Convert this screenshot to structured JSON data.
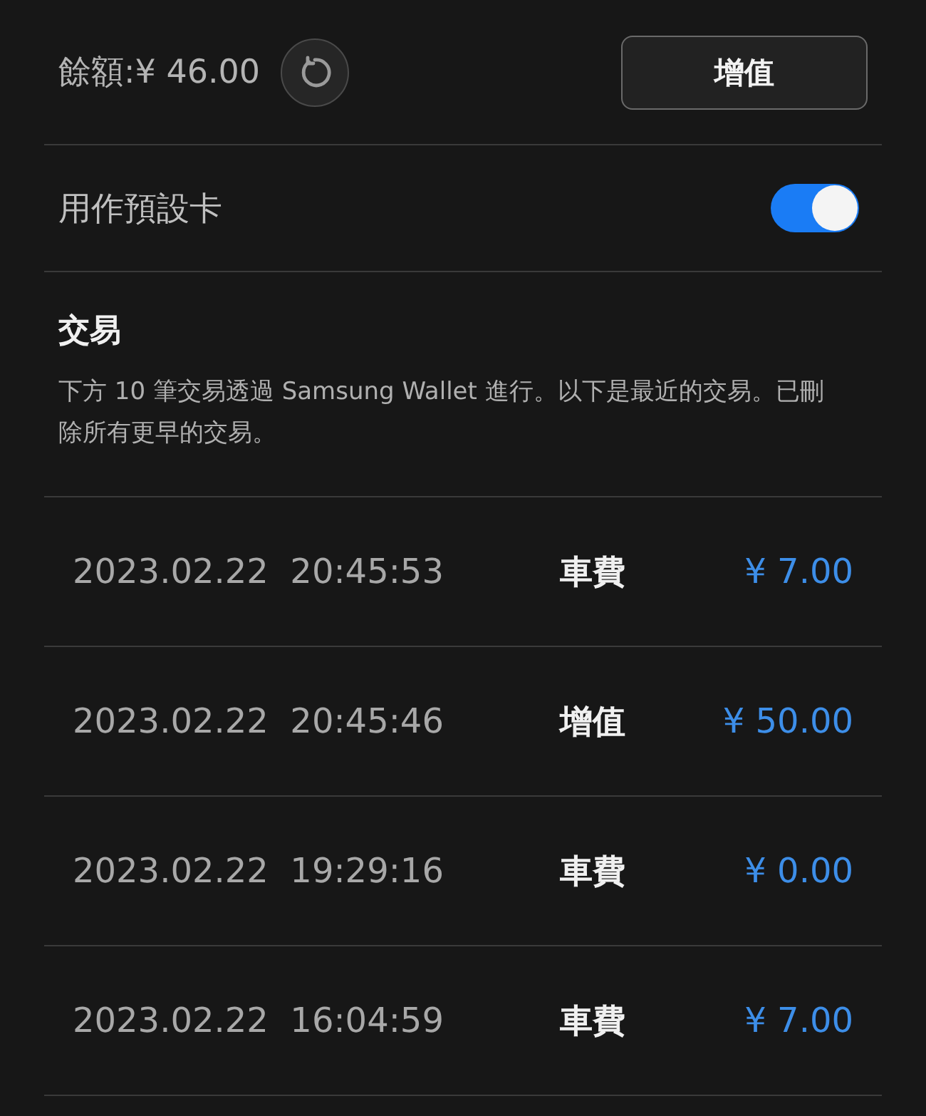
{
  "balance": {
    "text": "餘額:¥ 46.00"
  },
  "top_up_button": "增值",
  "default_card": {
    "label": "用作預設卡",
    "on": true
  },
  "transactions": {
    "title": "交易",
    "description": "下方 10 筆交易透過 Samsung Wallet 進行。以下是最近的交易。已刪除所有更早的交易。",
    "rows": [
      {
        "datetime": "2023.02.22  20:45:53",
        "type": "車費",
        "amount": "¥ 7.00"
      },
      {
        "datetime": "2023.02.22  20:45:46",
        "type": "增值",
        "amount": "¥ 50.00"
      },
      {
        "datetime": "2023.02.22  19:29:16",
        "type": "車費",
        "amount": "¥ 0.00"
      },
      {
        "datetime": "2023.02.22  16:04:59",
        "type": "車費",
        "amount": "¥ 7.00"
      }
    ]
  }
}
